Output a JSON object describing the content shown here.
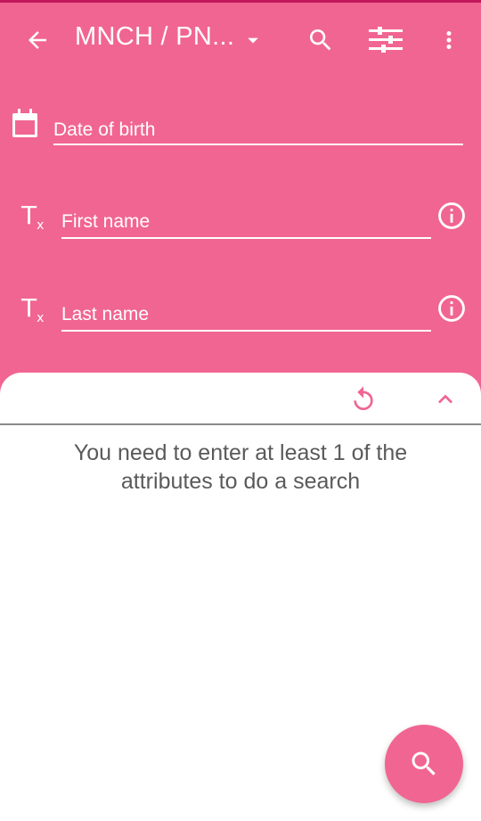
{
  "appbar": {
    "title": "MNCH / PN...",
    "back_icon": "arrow-back-icon",
    "dropdown_icon": "caret-down-icon",
    "search_icon": "search-icon",
    "filter_icon": "filter-sliders-icon",
    "overflow_icon": "more-vert-icon"
  },
  "form": {
    "fields": [
      {
        "label": "Date of birth",
        "icon": "calendar-icon"
      },
      {
        "label": "First name",
        "icon": "text-format-icon",
        "trailing_icon": "info-icon"
      },
      {
        "label": "Last name",
        "icon": "text-format-icon",
        "trailing_icon": "info-icon"
      }
    ]
  },
  "sheet": {
    "reset_icon": "refresh-icon",
    "collapse_icon": "chevron-up-icon",
    "message": "You need to enter at least 1 of the attributes to do a search"
  },
  "fab": {
    "icon": "search-icon"
  },
  "colors": {
    "primary": "#f16592",
    "primary_dark": "#c2185b",
    "sheet_bg": "#ffffff",
    "message_text": "#5a5a5a"
  }
}
